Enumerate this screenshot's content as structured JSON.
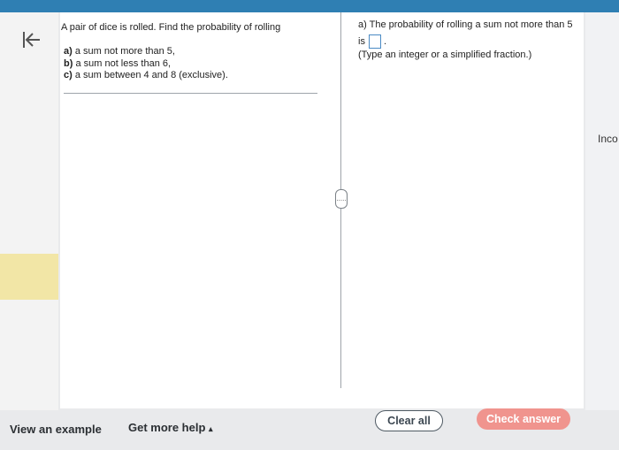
{
  "question": {
    "title": "A pair of dice is rolled. Find the probability of rolling",
    "parts": [
      {
        "label": "a)",
        "text": "a sum not more than 5,"
      },
      {
        "label": "b)",
        "text": "a sum not less than 6,"
      },
      {
        "label": "c)",
        "text": "a sum between 4 and 8 (exclusive)."
      }
    ]
  },
  "answer": {
    "prompt": "a) The probability of rolling a sum not more than 5",
    "is_text": "is",
    "input_value": "",
    "hint": "(Type an integer or a simplified fraction.)"
  },
  "side_panel": {
    "text": "Inco"
  },
  "splitter": {
    "label": "....."
  },
  "footer": {
    "view_example": "View an example",
    "get_more_help": "Get more help",
    "get_more_help_caret": "▴",
    "clear_all": "Clear all",
    "check_answer": "Check answer"
  },
  "colors": {
    "topbar": "#2f7fb3",
    "check_button": "#f0948e",
    "highlight": "#f2e6a6"
  },
  "icons": {
    "back": "back-to-start-icon"
  }
}
